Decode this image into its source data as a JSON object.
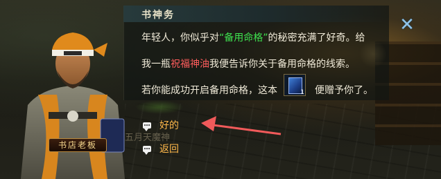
{
  "dialog": {
    "title": "书神务",
    "line1_prefix": "年轻人，你似乎对",
    "line1_highlight": "“备用命格”",
    "line1_suffix": "的秘密充满了好奇。给",
    "line2_prefix": "我一瓶",
    "line2_highlight": "祝福神油",
    "line2_suffix": "我便告诉你关于备用命格的线索。",
    "line3_prefix": "若你能成功开启备用命格，这本",
    "line3_suffix": "便赠予你了。",
    "item": {
      "icon": "blue-book-icon",
      "count": "1"
    }
  },
  "options": [
    {
      "label": "好的"
    },
    {
      "label": "返回"
    }
  ],
  "npc": {
    "name": "书店老板"
  },
  "background_text": "五月天魔神",
  "colors": {
    "highlight_green": "#3ee04f",
    "highlight_red": "#ff5d5d",
    "option_orange": "#ffb84a",
    "arrow_red": "#f05a5a"
  }
}
